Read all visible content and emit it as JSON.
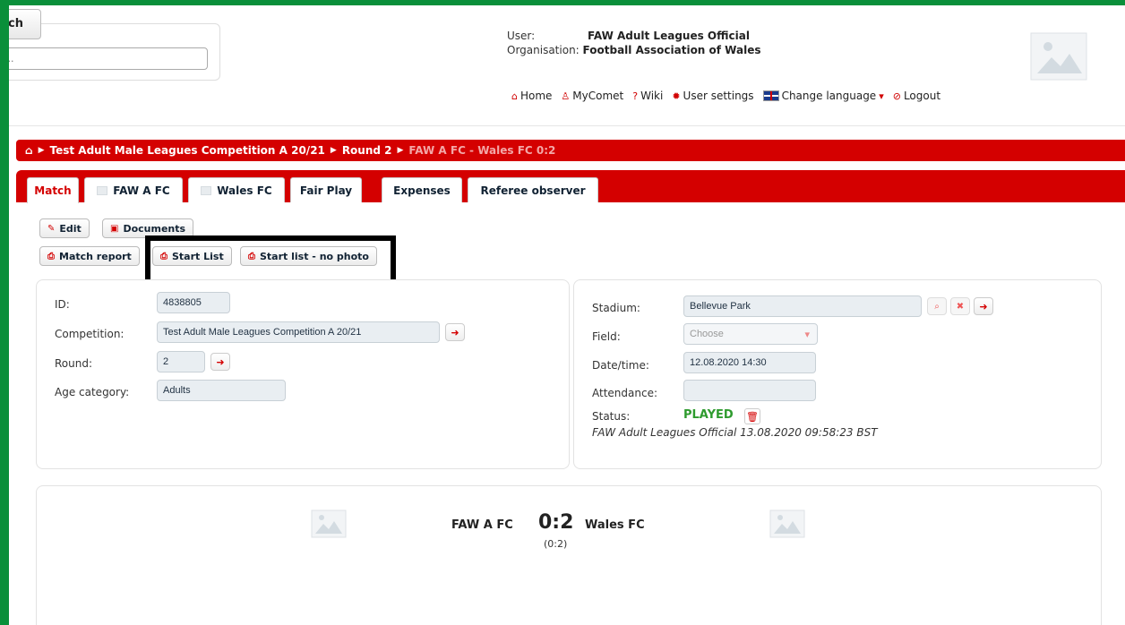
{
  "search": {
    "button_label": "ch",
    "placeholder": "..."
  },
  "user": {
    "user_label": "User:",
    "user_value": "FAW Adult Leagues Official",
    "org_label": "Organisation:",
    "org_value": "Football Association of Wales"
  },
  "nav": {
    "home": "Home",
    "mycomet": "MyComet",
    "wiki": "Wiki",
    "user_settings": "User settings",
    "change_language": "Change language",
    "logout": "Logout"
  },
  "breadcrumb": {
    "competition": "Test Adult Male Leagues Competition A 20/21",
    "round": "Round 2",
    "current": "FAW A FC - Wales FC 0:2"
  },
  "tabs": [
    {
      "label": "Match"
    },
    {
      "label": "FAW A FC"
    },
    {
      "label": "Wales FC"
    },
    {
      "label": "Fair Play"
    },
    {
      "label": "Expenses"
    },
    {
      "label": "Referee observer"
    }
  ],
  "actions": {
    "edit": "Edit",
    "documents": "Documents",
    "match_report": "Match report",
    "start_list": "Start List",
    "start_list_no_photo": "Start list - no photo"
  },
  "details": {
    "id_label": "ID:",
    "id_value": "4838805",
    "competition_label": "Competition:",
    "competition_value": "Test Adult Male Leagues Competition A 20/21",
    "round_label": "Round:",
    "round_value": "2",
    "age_label": "Age category:",
    "age_value": "Adults"
  },
  "venue": {
    "stadium_label": "Stadium:",
    "stadium_value": "Bellevue Park",
    "field_label": "Field:",
    "field_placeholder": "Choose",
    "datetime_label": "Date/time:",
    "datetime_value": "12.08.2020 14:30",
    "attendance_label": "Attendance:",
    "attendance_value": "",
    "status_label": "Status:",
    "status_value": "PLAYED",
    "status_note": "FAW Adult Leagues Official 13.08.2020 09:58:23 BST"
  },
  "score": {
    "home_team": "FAW A FC",
    "away_team": "Wales FC",
    "score": "0:2",
    "half_time": "(0:2)"
  },
  "colors": {
    "accent": "#d40000",
    "frame": "#0a8f3a",
    "played": "#2e9b2e"
  }
}
